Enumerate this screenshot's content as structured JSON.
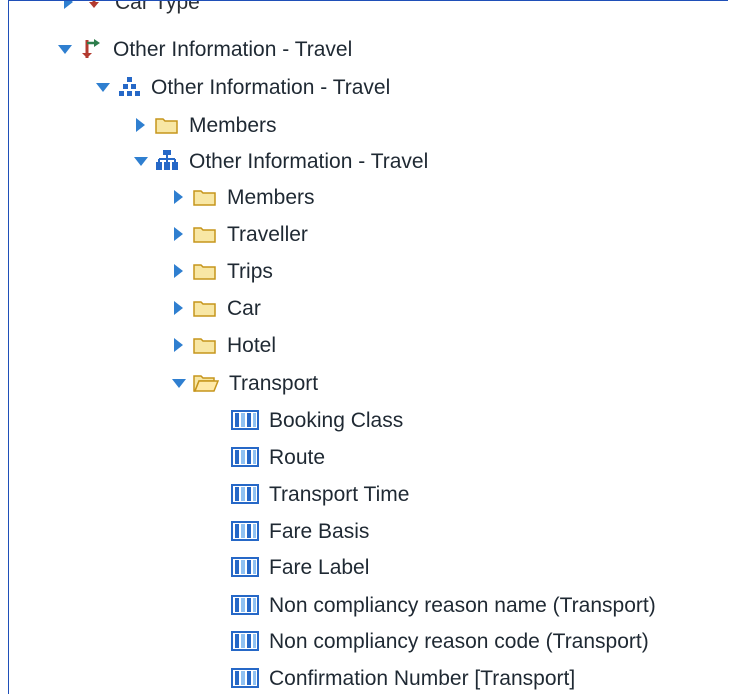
{
  "tree": {
    "items": [
      {
        "label": "Car Type",
        "expanded": false,
        "icon": "hierarchy-arrow-icon"
      },
      {
        "label": "Other Information - Travel",
        "expanded": true,
        "icon": "branch-icon"
      },
      {
        "label": "Other Information - Travel",
        "expanded": true,
        "icon": "small-hierarchy-icon"
      },
      {
        "label": "Members",
        "expanded": false,
        "icon": "folder-icon"
      },
      {
        "label": "Other Information - Travel",
        "expanded": true,
        "icon": "org-chart-icon"
      },
      {
        "label": "Members",
        "expanded": false,
        "icon": "folder-icon"
      },
      {
        "label": "Traveller",
        "expanded": false,
        "icon": "folder-icon"
      },
      {
        "label": "Trips",
        "expanded": false,
        "icon": "folder-icon"
      },
      {
        "label": "Car",
        "expanded": false,
        "icon": "folder-icon"
      },
      {
        "label": "Hotel",
        "expanded": false,
        "icon": "folder-icon"
      },
      {
        "label": "Transport",
        "expanded": true,
        "icon": "open-folder-icon"
      },
      {
        "label": "Booking Class",
        "icon": "column-icon"
      },
      {
        "label": "Route",
        "icon": "column-icon"
      },
      {
        "label": "Transport Time",
        "icon": "column-icon"
      },
      {
        "label": "Fare Basis",
        "icon": "column-icon"
      },
      {
        "label": "Fare Label",
        "icon": "column-icon"
      },
      {
        "label": "Non compliancy reason name (Transport)",
        "icon": "column-icon"
      },
      {
        "label": "Non compliancy reason code (Transport)",
        "icon": "column-icon"
      },
      {
        "label": "Confirmation Number [Transport]",
        "icon": "column-icon"
      }
    ]
  },
  "colors": {
    "tree_border": "#1f4fb8",
    "expander": "#2f7fd0",
    "folder_fill": "#f8e7a5",
    "folder_stroke": "#c6951c",
    "hierarchy_blue": "#2668c7",
    "branch_red": "#b33a2f",
    "branch_green": "#2c7d4b"
  }
}
